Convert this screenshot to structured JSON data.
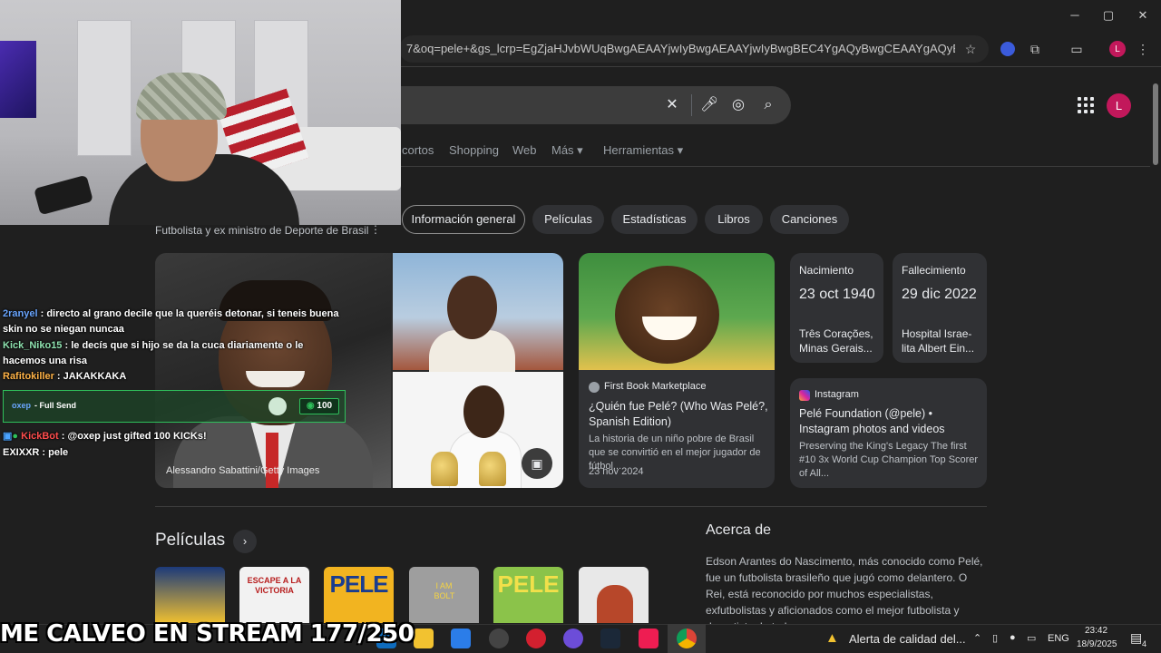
{
  "browser": {
    "url": "7&oq=pele+&gs_lcrp=EgZjaHJvbWUqBwgAEAAYjwIyBwgAEAAYjwIyBwgBEC4YgAQyBwgCEAAYgAQyBwgDEAAYgAQy...",
    "profile_initial": "L",
    "window_controls": {
      "minimize": "─",
      "maximize": "▢",
      "close": "✕"
    }
  },
  "search": {
    "profile_initial": "L",
    "nav_tabs": [
      "cortos",
      "Shopping",
      "Web",
      "Más ▾",
      "Herramientas ▾"
    ]
  },
  "knowledge": {
    "chips": [
      "Información general",
      "Películas",
      "Estadísticas",
      "Libros",
      "Canciones"
    ],
    "subtitle": "Futbolista y ex ministro de Deporte de Brasil",
    "image_credit": "Alessandro Sabattini/Getty Images",
    "book_card": {
      "source": "First Book Marketplace",
      "title": "¿Quién fue Pelé? (Who Was Pelé?, Spanish Edition)",
      "snippet": "La historia de un niño pobre de Brasil que se convirtió en el mejor jugador de fútbol...",
      "date": "23 nov 2024"
    },
    "birth": {
      "label": "Nacimiento",
      "date": "23 oct 1940",
      "place": "Três Corações, Minas Gerais..."
    },
    "death": {
      "label": "Fallecimiento",
      "date": "29 dic 2022",
      "place": "Hospital Israe-lita Albert Ein..."
    },
    "instagram_card": {
      "source": "Instagram",
      "title": "Pelé Foundation (@pele) • Instagram photos and videos",
      "snippet": "Preserving the King's Legacy The first #10 3x World Cup Champion Top Scorer of All..."
    },
    "movies_heading": "Películas",
    "about_heading": "Acerca de",
    "about_text": "Edson Arantes do Nascimento, más conocido como Pelé, fue un futbolista brasileño que jugó como delantero. O Rei, está reconocido por muchos especialistas, exfutbolistas y aficionados como el mejor futbolista y deportista de todos",
    "posters": [
      {
        "text": "",
        "bg": "#1c3a7a"
      },
      {
        "text": "ESCAPE A LA VICTORIA",
        "bg": "#f2f2f2"
      },
      {
        "text": "PELE",
        "bg": "#f2b420"
      },
      {
        "text": "I AM BOLT",
        "bg": "#9e9e9e"
      },
      {
        "text": "PELE",
        "bg": "#8bc34a"
      },
      {
        "text": "",
        "bg": "#e8e8e8"
      }
    ]
  },
  "stream": {
    "chat": [
      {
        "user": "2ranyel",
        "color": "#6aa6ff",
        "text": "directo al grano decile que la queréis detonar, si teneis buena skin no se niegan nuncaa"
      },
      {
        "user": "Kick_Niko15",
        "color": "#8fe3b0",
        "text": "le decís que si hijo se da la cuca diariamente o le hacemos una risa"
      },
      {
        "user": "Rafitokiller",
        "color": "#ffb347",
        "text": "JAKAKKAKA"
      },
      {
        "user": "KickBot",
        "color": "#ff4d4d",
        "text": "@oxep just gifted 100 KICKs!"
      },
      {
        "user": "EXIXXR",
        "color": "#ffffff",
        "text": "pele"
      }
    ],
    "gift": {
      "user": "oxep",
      "text": "- Full Send",
      "count": "100"
    },
    "ticker": "ME CALVEO EN STREAM 177/250"
  },
  "taskbar": {
    "notification": "Alerta de calidad del...",
    "lang": "ENG",
    "time": "23:42",
    "date": "18/9/2025",
    "notif_count": "4"
  }
}
